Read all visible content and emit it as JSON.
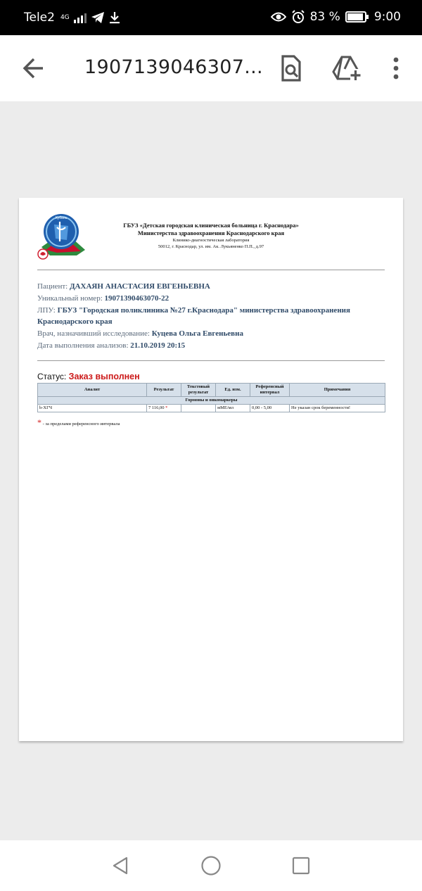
{
  "statusbar": {
    "carrier": "Tele2",
    "network": "4G",
    "battery": "83 %",
    "time": "9:00"
  },
  "toolbar": {
    "title": "1907139046307..."
  },
  "document": {
    "header_line1": "ГБУЗ «Детская городская клиническая больница г. Краснодара»",
    "header_line2": "Министерства здравоохранения Краснодарского края",
    "header_line3": "Клинико-диагностическая лаборатория",
    "header_line4": "50012, г. Краснодар, ул. им. Ак. Лукьяненко П.П., д.97",
    "logo_text": "Кубань",
    "patient": {
      "label": "Пациент:",
      "value": "ДАХАЯН АНАСТАСИЯ ЕВГЕНЬЕВНА"
    },
    "unique": {
      "label": "Уникальный номер:",
      "value": "19071390463070-22"
    },
    "lpu": {
      "label": "ЛПУ:",
      "value": "ГБУЗ \"Городская поликлиника №27 г.Краснодара\" министерства здравоохранения Краснодарского края"
    },
    "doctor": {
      "label": "Врач, назначивший исследование:",
      "value": "Куцева Ольга Евгеньевна"
    },
    "date": {
      "label": "Дата выполнения анализов:",
      "value": "21.10.2019 20:15"
    },
    "status": {
      "label": "Статус:",
      "value": "Заказ выполнен"
    },
    "table": {
      "headers": {
        "analyte": "Аналит",
        "result": "Результат",
        "text_result": "Текстовый результат",
        "unit": "Ед. изм.",
        "reference": "Референсный интервал",
        "notes": "Примечания"
      },
      "group": "Гормоны и онкомаркеры",
      "row": {
        "analyte": "b-ХГЧ",
        "result": "7 116,00",
        "flag": "*",
        "text_result": "",
        "unit": "мМЕ/мл",
        "reference": "0,00 - 5,00",
        "notes": "Не указан срок беременности!"
      }
    },
    "footnote": {
      "star": "*",
      "text": "- за пределами референсного интервала"
    }
  },
  "colors": {
    "accent_red": "#cc1a1a",
    "label_gray": "#5b6a7b",
    "value_blue": "#2f4a68",
    "table_header": "#d6e0ea"
  },
  "icons": [
    "back-arrow-icon",
    "document-search-icon",
    "drive-add-icon",
    "more-vert-icon",
    "nav-back-icon",
    "nav-home-icon",
    "nav-recents-icon"
  ]
}
